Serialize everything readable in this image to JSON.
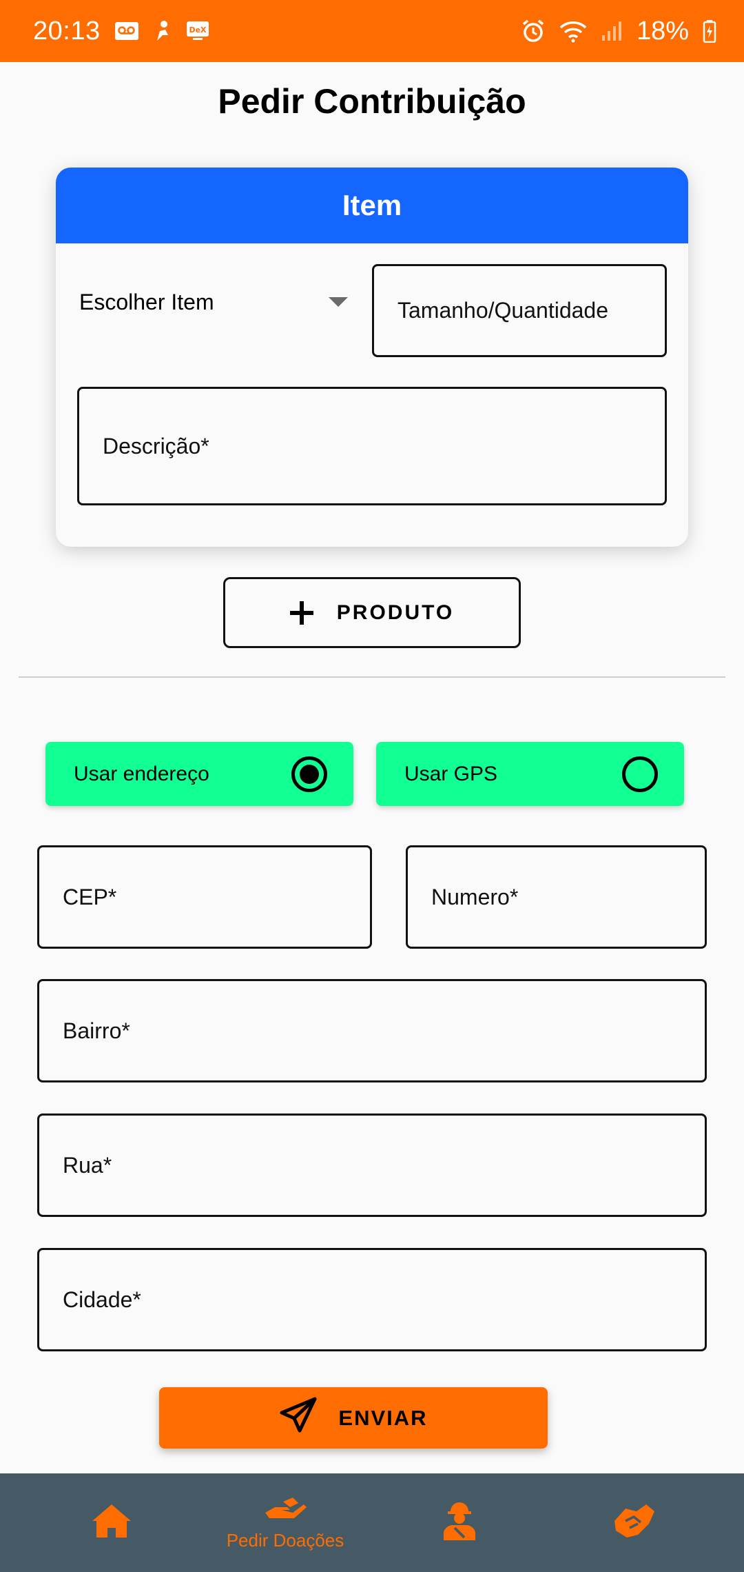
{
  "status_bar": {
    "time": "20:13",
    "battery": "18%",
    "left_icons": [
      "voicemail-icon",
      "person-icon",
      "dex-icon"
    ],
    "right_icons": [
      "alarm-icon",
      "wifi-icon",
      "signal-icon",
      "battery-icon"
    ],
    "dex_label": "DeX"
  },
  "page": {
    "title": "Pedir Contribuição"
  },
  "item_card": {
    "header": "Item",
    "select_label": "Escolher Item",
    "quantity_placeholder": "Tamanho/Quantidade",
    "description_placeholder": "Descrição*"
  },
  "add_product": {
    "label": "PRODUTO",
    "icon": "plus-icon"
  },
  "address_mode": {
    "options": [
      {
        "label": "Usar endereço",
        "selected": true
      },
      {
        "label": "Usar GPS",
        "selected": false
      }
    ]
  },
  "address_fields": {
    "cep": "CEP*",
    "numero": "Numero*",
    "bairro": "Bairro*",
    "rua": "Rua*",
    "cidade": "Cidade*"
  },
  "submit": {
    "label": "ENVIAR",
    "icon": "send-icon"
  },
  "bottom_nav": {
    "items": [
      {
        "icon": "home-icon",
        "label": ""
      },
      {
        "icon": "hand-give-icon",
        "label": "Pedir Doações",
        "active": true
      },
      {
        "icon": "volunteer-icon",
        "label": ""
      },
      {
        "icon": "handshake-icon",
        "label": ""
      }
    ]
  },
  "colors": {
    "accent_orange": "#ff6d00",
    "header_blue": "#1565ff",
    "toggle_green": "#12ff94",
    "nav_background": "#455a64"
  }
}
